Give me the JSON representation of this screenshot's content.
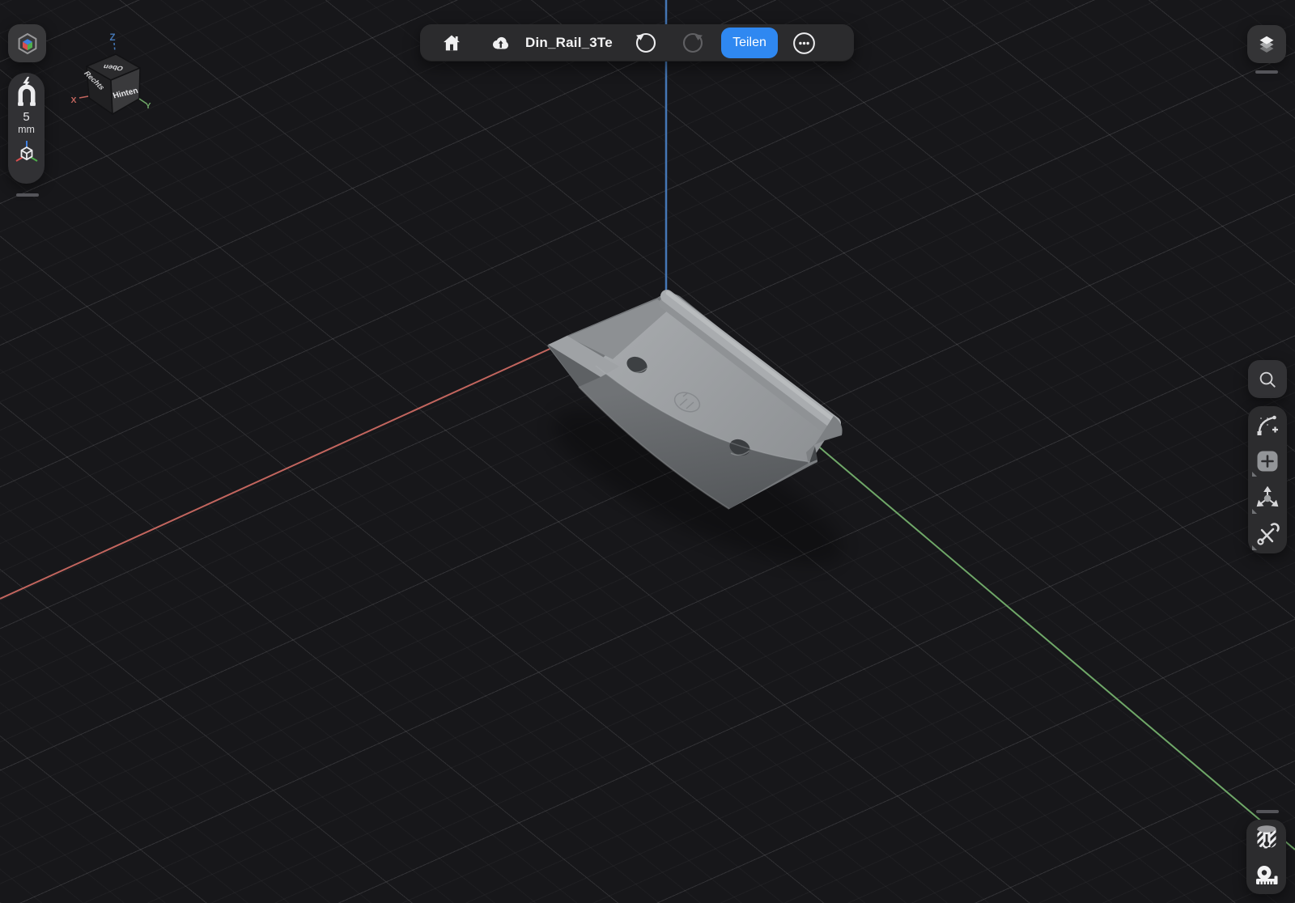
{
  "top_toolbar": {
    "title": "Din_Rail_3Te",
    "share_label": "Teilen"
  },
  "snap_panel": {
    "value": "5",
    "unit": "mm"
  },
  "view_cube": {
    "face_top": "Oben",
    "face_side": "Rechts",
    "face_front": "Hinten"
  },
  "axes": {
    "x_label": "X",
    "y_label": "Y",
    "z_label": "Z",
    "x_color": "#c2655e",
    "y_color": "#6fa868",
    "z_color": "#4577b5"
  },
  "viewport": {
    "background_color": "#17171a",
    "model_color": "#9ba0a3",
    "model_description": "Gray DIN rail solid body with two mounting holes and engraved logo"
  },
  "colors": {
    "accent_blue": "#2f88f1",
    "panel_background": "#2b2b2d"
  }
}
